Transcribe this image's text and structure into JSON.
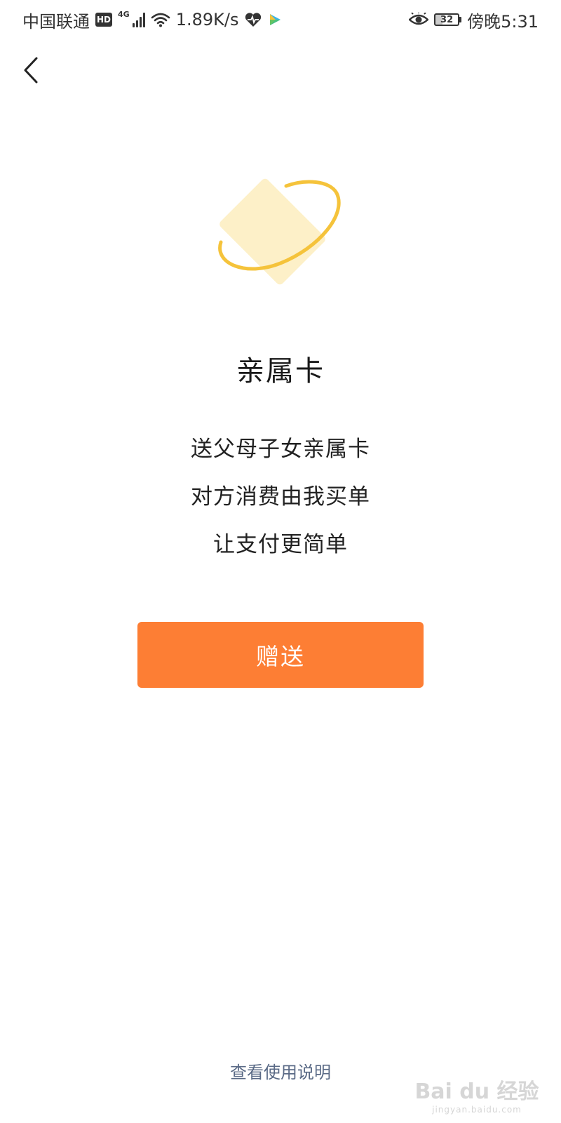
{
  "status_bar": {
    "carrier": "中国联通",
    "hd": "HD",
    "network_type": "4G",
    "speed": "1.89K/s",
    "battery_level": "32",
    "time": "傍晚5:31"
  },
  "nav": {
    "back_icon": "chevron-left-icon"
  },
  "hero": {
    "icon": "family-card-illustration",
    "card_color": "#fdf0c8",
    "ring_color": "#f5c33b"
  },
  "main": {
    "title": "亲属卡",
    "description": [
      "送父母子女亲属卡",
      "对方消费由我买单",
      "让支付更简单"
    ],
    "gift_button_label": "赠送",
    "gift_button_color": "#fd7e34"
  },
  "footer": {
    "help_link": "查看使用说明"
  },
  "watermark": {
    "main": "Bai du 经验",
    "sub": "jingyan.baidu.com"
  }
}
